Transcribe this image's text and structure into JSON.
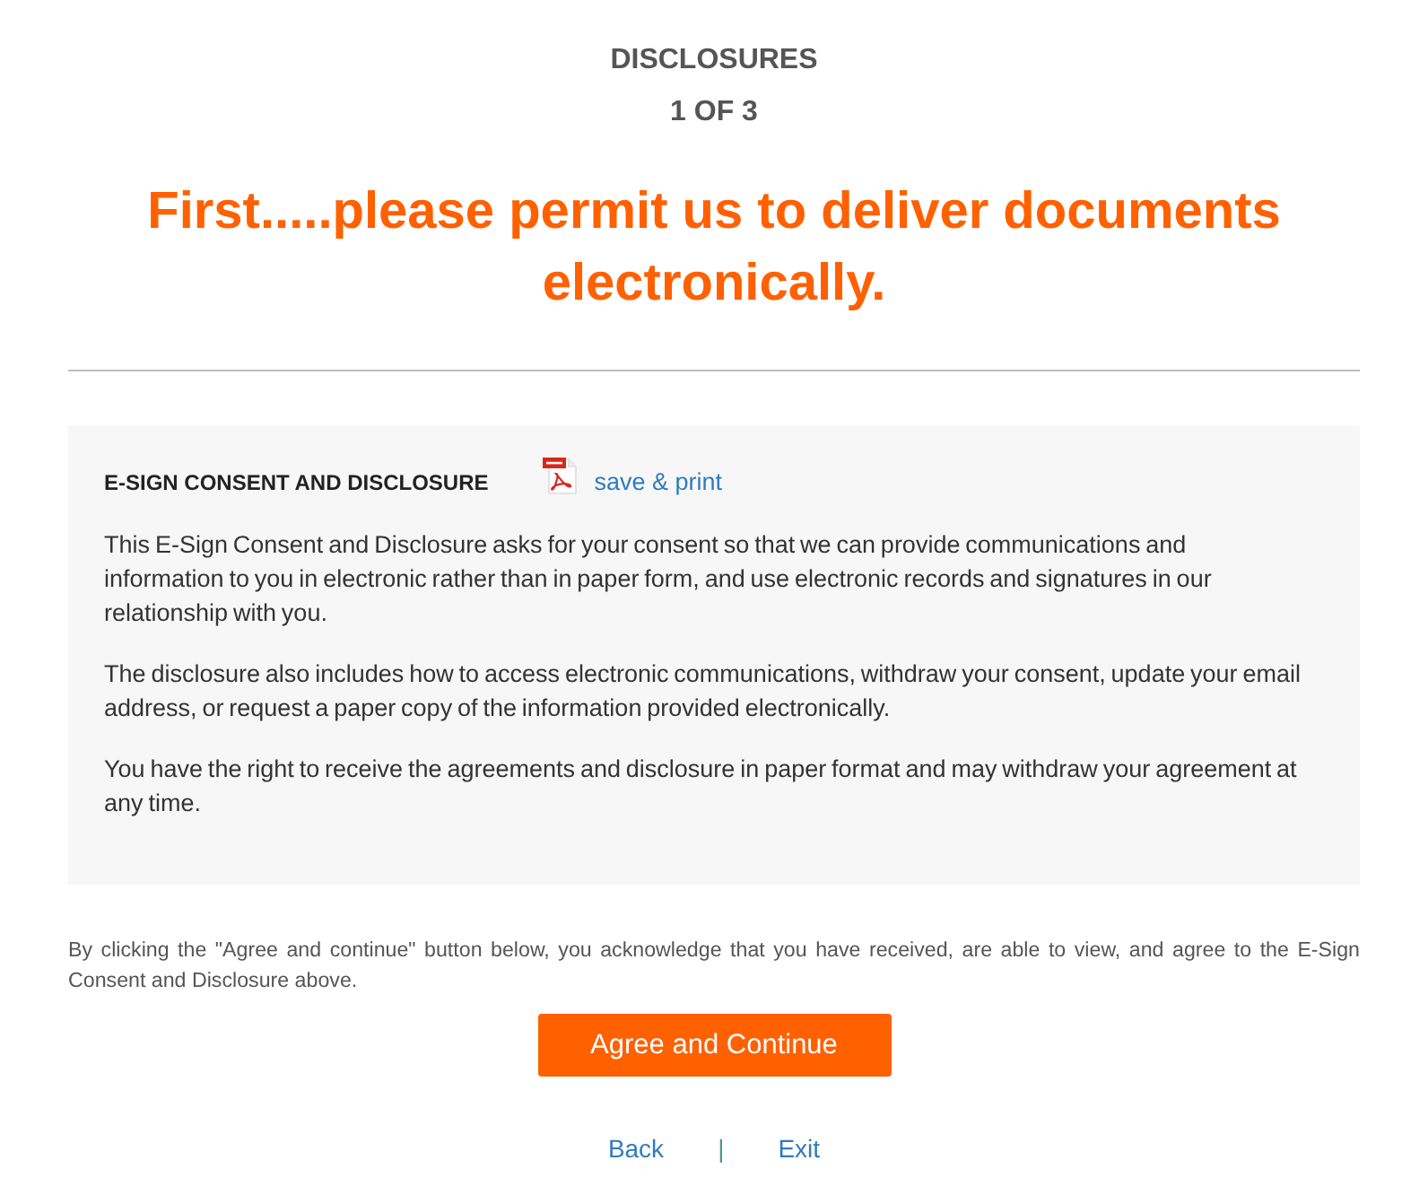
{
  "header": {
    "section": "DISCLOSURES",
    "step": "1 OF 3",
    "headline": "First.....please permit us to deliver documents electronically."
  },
  "disclosure": {
    "title": "E-SIGN CONSENT AND DISCLOSURE",
    "print_link": "save & print",
    "paragraphs": [
      "This E-Sign Consent and Disclosure asks for your consent so that we can provide communications and information to you in electronic rather than in paper form, and use electronic records and signatures in our relationship with you.",
      "The disclosure also includes how to access electronic communications, withdraw your consent, update your email address, or request a paper copy of the information provided electronically.",
      "You have the right to receive the agreements and disclosure in paper format and may withdraw your agreement at any time."
    ]
  },
  "agreement_note": "By clicking the \"Agree and continue\" button below, you acknowledge that you have received, are able to view, and agree to the E-Sign Consent and Disclosure above.",
  "primary_button": "Agree and Continue",
  "footer": {
    "links": [
      "Back",
      "Exit"
    ],
    "separator": "|"
  }
}
